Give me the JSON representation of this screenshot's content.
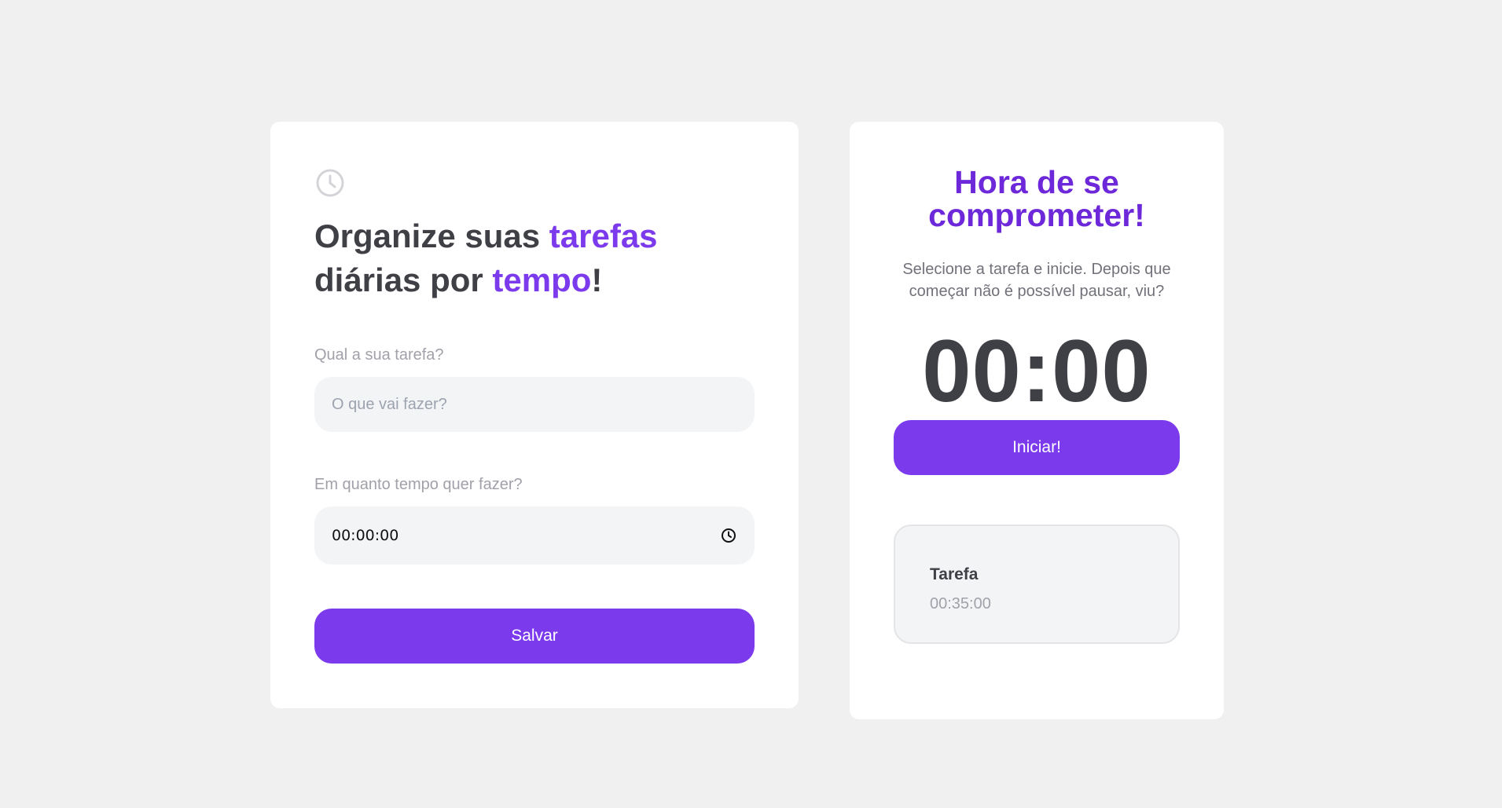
{
  "colors": {
    "background": "#f0f0f0",
    "accent": "#7c3aed",
    "title_accent": "#6d28d9",
    "text_dark": "#3f3f46",
    "text_muted": "#a1a1aa"
  },
  "form": {
    "icon": "clock-icon",
    "headline": {
      "part1": "Organize suas ",
      "accent1": "tarefas",
      "part2": " diárias por ",
      "accent2": "tempo",
      "end": "!"
    },
    "task_label": "Qual a sua tarefa?",
    "task_placeholder": "O que vai fazer?",
    "task_value": "",
    "time_label": "Em quanto tempo quer fazer?",
    "time_value": "00:00:00",
    "save_label": "Salvar"
  },
  "timer_panel": {
    "title": "Hora de se comprometer!",
    "subtitle": "Selecione a tarefa e inicie. Depois que começar não é possível pausar, viu?",
    "timer": "00:00",
    "start_label": "Iniciar!",
    "tasks": [
      {
        "name": "Tarefa",
        "time": "00:35:00"
      }
    ]
  }
}
